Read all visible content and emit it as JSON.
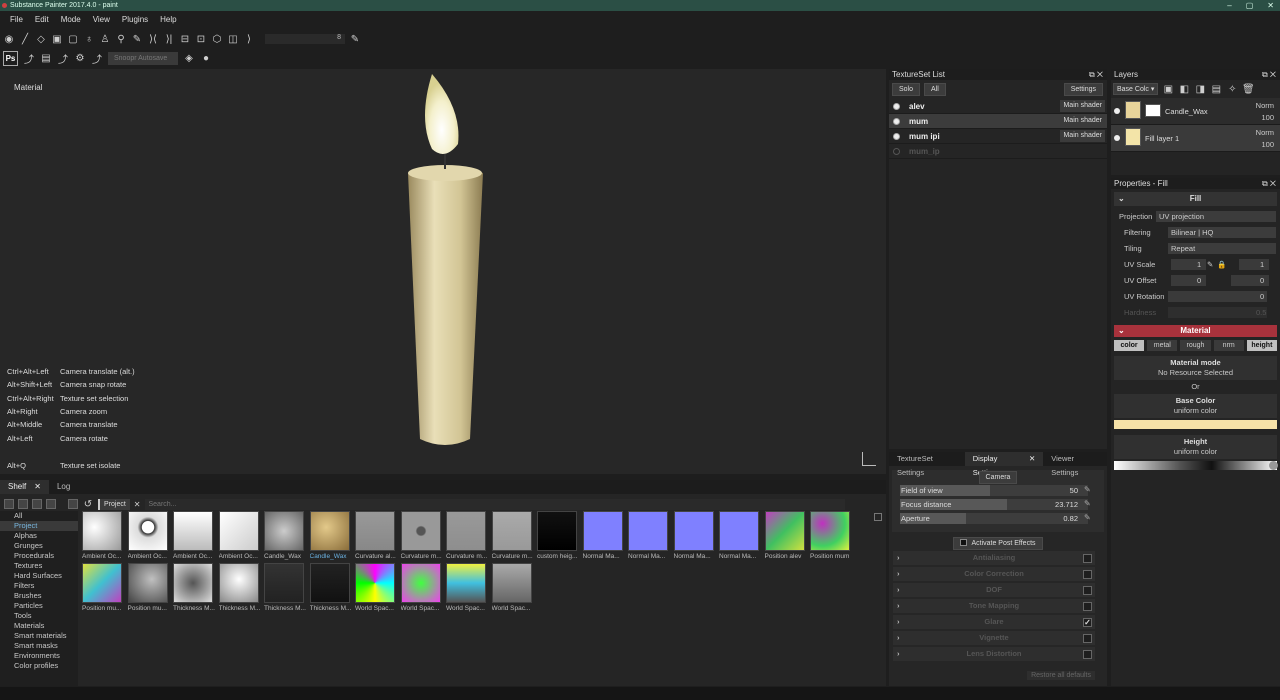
{
  "window": {
    "title": "Substance Painter 2017.4.0 - paint",
    "min": "–",
    "max": "▢",
    "close": "✕"
  },
  "menu": [
    "File",
    "Edit",
    "Mode",
    "View",
    "Plugins",
    "Help"
  ],
  "toolbar": {
    "brush_size": "8",
    "autosave": "Snoopr Autosave"
  },
  "viewport": {
    "label": "Material",
    "shortcuts": [
      {
        "keys": "Ctrl+Alt+Left",
        "action": "Camera translate (alt.)"
      },
      {
        "keys": "Alt+Shift+Left",
        "action": "Camera snap rotate"
      },
      {
        "keys": "Ctrl+Alt+Right",
        "action": "Texture set selection"
      },
      {
        "keys": "Alt+Right",
        "action": "Camera zoom"
      },
      {
        "keys": "Alt+Middle",
        "action": "Camera translate"
      },
      {
        "keys": "Alt+Left",
        "action": "Camera rotate"
      },
      {
        "keys": "Alt+Q",
        "action": "Texture set isolate"
      }
    ]
  },
  "shelf": {
    "tab_shelf": "Shelf",
    "tab_log": "Log",
    "project_tag": "Project",
    "search_placeholder": "Search...",
    "categories": [
      "All",
      "Project",
      "Alphas",
      "Grunges",
      "Procedurals",
      "Textures",
      "Hard Surfaces",
      "Filters",
      "Brushes",
      "Particles",
      "Tools",
      "Materials",
      "Smart materials",
      "Smart masks",
      "Environments",
      "Color profiles"
    ],
    "selected_category": "Project",
    "row1": [
      "Ambient Oc...",
      "Ambient Oc...",
      "Ambient Oc...",
      "Ambient Oc...",
      "Candle_Wax",
      "Candle_Wax",
      "Curvature al...",
      "Curvature m...",
      "Curvature m...",
      "Curvature m...",
      "custom heig...",
      "Normal Ma...",
      "Normal Ma...",
      "Normal Ma...",
      "Normal Ma...",
      "Position alev",
      "Position mum"
    ],
    "row2": [
      "Position mu...",
      "Position mu...",
      "Thickness M...",
      "Thickness M...",
      "Thickness M...",
      "Thickness M...",
      "World Spac...",
      "World Spac...",
      "World Spac...",
      "World Spac..."
    ]
  },
  "textureset_list": {
    "title": "TextureSet List",
    "solo": "Solo",
    "all": "All",
    "settings": "Settings",
    "items": [
      {
        "name": "alev",
        "shader": "Main shader",
        "selected": false
      },
      {
        "name": "mum",
        "shader": "Main shader",
        "selected": true
      },
      {
        "name": "mum ipi",
        "shader": "Main shader",
        "selected": false
      },
      {
        "name": "mum_ip",
        "shader": "",
        "selected": false
      }
    ]
  },
  "display": {
    "tabs": [
      "TextureSet Settings",
      "Display Settings",
      "Viewer Settings"
    ],
    "camera": "Camera",
    "fov_label": "Field of view",
    "fov": "50",
    "focus_label": "Focus distance",
    "focus": "23.712",
    "aperture_label": "Aperture",
    "aperture": "0.82",
    "post_effects": "Activate Post Effects",
    "sections": [
      "Antialiasing",
      "Color Correction",
      "DOF",
      "Tone Mapping",
      "Glare",
      "Vignette",
      "Lens Distortion"
    ],
    "restore": "Restore all defaults"
  },
  "layers": {
    "title": "Layers",
    "channel": "Base Colc",
    "items": [
      {
        "name": "Candle_Wax",
        "blend": "Norm",
        "opacity": "100"
      },
      {
        "name": "Fill layer 1",
        "blend": "Norm",
        "opacity": "100"
      }
    ]
  },
  "properties": {
    "title": "Properties - Fill",
    "fill": "Fill",
    "projection_label": "Projection",
    "projection": "UV projection",
    "filtering_label": "Filtering",
    "filtering": "Bilinear | HQ",
    "tiling_label": "Tiling",
    "tiling": "Repeat",
    "uvscale_label": "UV Scale",
    "uvscale_u": "1",
    "uvscale_v": "1",
    "uvoffset_label": "UV Offset",
    "uvoffset_u": "0",
    "uvoffset_v": "0",
    "uvrot_label": "UV Rotation",
    "uvrot": "0",
    "hardness_label": "Hardness",
    "hardness": "0.5",
    "material": "Material",
    "channels": [
      "color",
      "metal",
      "rough",
      "nrm",
      "height"
    ],
    "mat_mode_label": "Material mode",
    "mat_mode": "No Resource Selected",
    "or": "Or",
    "base_color_label": "Base Color",
    "base_color_mode": "uniform color",
    "height_label": "Height",
    "height_mode": "uniform color"
  }
}
